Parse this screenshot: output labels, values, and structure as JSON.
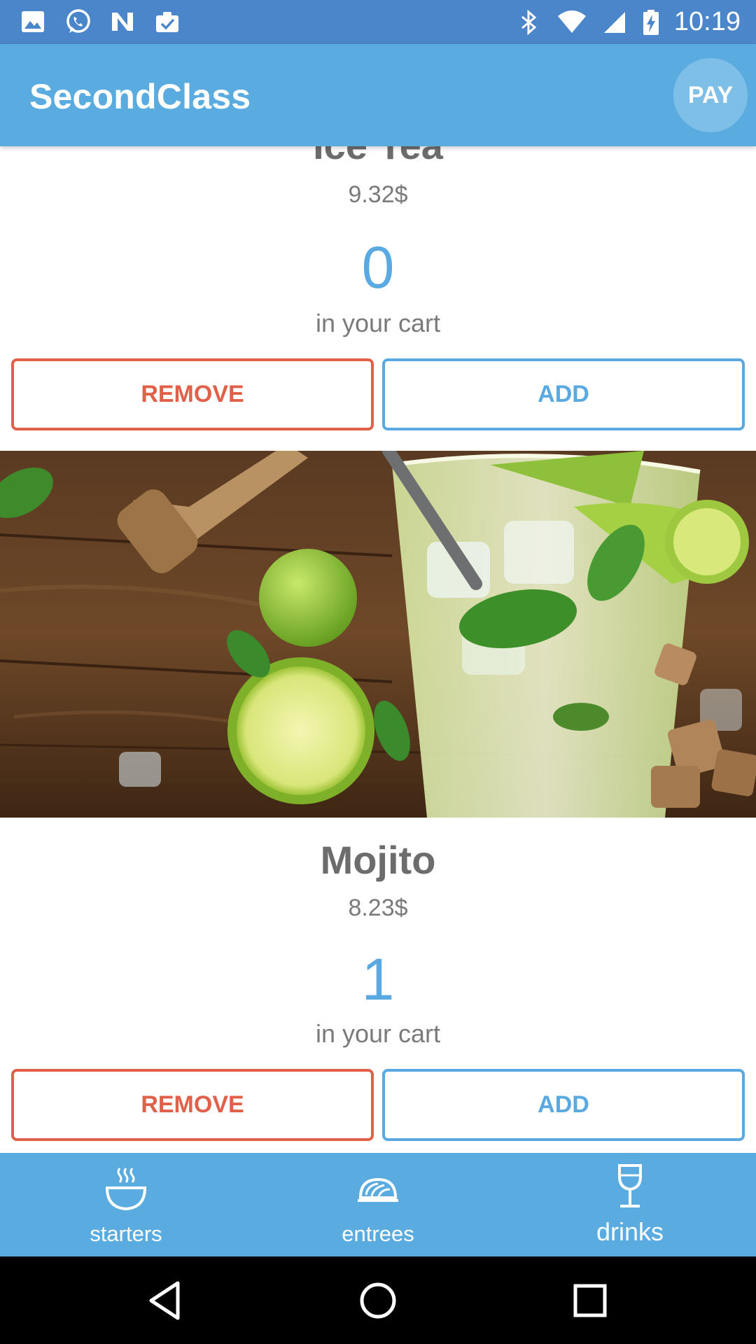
{
  "status_bar": {
    "time": "10:19",
    "left_icons": [
      "image-icon",
      "whatsapp-icon",
      "n-app-icon",
      "clipboard-check-icon"
    ],
    "right_icons": [
      "bluetooth-icon",
      "wifi-icon",
      "signal-icon",
      "battery-charging-icon"
    ]
  },
  "app_bar": {
    "title": "SecondClass",
    "pay_label": "PAY"
  },
  "products": [
    {
      "name": "Ice Tea",
      "price": "9.32$",
      "count": "0",
      "cart_label": "in your cart",
      "remove_label": "REMOVE",
      "add_label": "ADD"
    },
    {
      "name": "Mojito",
      "price": "8.23$",
      "count": "1",
      "cart_label": "in your cart",
      "remove_label": "REMOVE",
      "add_label": "ADD",
      "image": "mojito-photo"
    }
  ],
  "bottom_nav": {
    "items": [
      {
        "label": "starters",
        "icon": "bowl-icon"
      },
      {
        "label": "entrees",
        "icon": "pasta-dish-icon"
      },
      {
        "label": "drinks",
        "icon": "wine-glass-icon"
      }
    ]
  },
  "system_nav": [
    "back-icon",
    "home-icon",
    "recents-icon"
  ],
  "colors": {
    "status_bar": "#4a86c9",
    "primary": "#5aace0",
    "accent_blue": "#5aa9e0",
    "remove_red": "#e0604a",
    "pay_button": "#7ebfe8",
    "text_gray": "#6c6c6c"
  }
}
